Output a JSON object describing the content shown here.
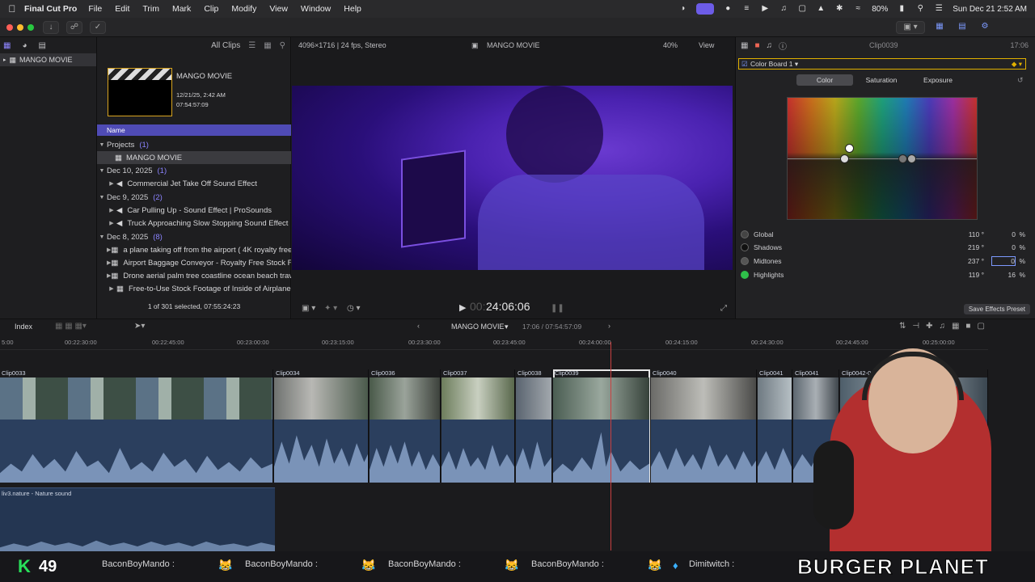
{
  "menubar": {
    "app": "Final Cut Pro",
    "items": [
      "File",
      "Edit",
      "Trim",
      "Mark",
      "Clip",
      "Modify",
      "View",
      "Window",
      "Help"
    ],
    "battery": "80%",
    "datetime": "Sun Dec 21  2:52 AM"
  },
  "library": {
    "name": "MANGO MOVIE"
  },
  "browser": {
    "filter": "All Clips",
    "project_card": {
      "title": "MANGO MOVIE",
      "date": "12/21/25, 2:42 AM",
      "duration": "07:54:57:09"
    },
    "column_header": "Name",
    "groups": [
      {
        "label": "Projects",
        "count": "(1)",
        "items": [
          "MANGO MOVIE"
        ]
      },
      {
        "label": "Dec 10, 2025",
        "count": "(1)",
        "items": [
          "Commercial Jet Take Off Sound Effect"
        ]
      },
      {
        "label": "Dec 9, 2025",
        "count": "(2)",
        "items": [
          "Car Pulling Up - Sound Effect  |  ProSounds",
          "Truck Approaching Slow Stopping Sound Effect"
        ]
      },
      {
        "label": "Dec 8, 2025",
        "count": "(8)",
        "items": [
          "a plane taking off from the airport ( 4K royalty free",
          "Airport Baggage Conveyor - Royalty Free Stock Fo",
          "Drone aerial palm tree coastline ocean beach trave",
          "Free-to-Use Stock Footage of Inside of Airplane"
        ]
      }
    ],
    "selection_status": "1 of 301 selected, 07:55:24:23"
  },
  "viewer": {
    "format": "4096×1716 | 24 fps, Stereo",
    "title": "MANGO MOVIE",
    "zoom": "40%",
    "view_label": "View",
    "timecode_dim": "00:",
    "timecode": "24:06:06"
  },
  "inspector": {
    "clip_name": "Clip0039",
    "duration": "17:06",
    "effect_name": "Color Board 1",
    "tabs": [
      "Color",
      "Saturation",
      "Exposure"
    ],
    "active_tab": "Color",
    "rows": [
      {
        "label": "Global",
        "angle": "110 °",
        "value": "0",
        "unit": "%"
      },
      {
        "label": "Shadows",
        "angle": "219 °",
        "value": "0",
        "unit": "%"
      },
      {
        "label": "Midtones",
        "angle": "237 °",
        "value": "0",
        "unit": "%"
      },
      {
        "label": "Highlights",
        "angle": "119 °",
        "value": "16",
        "unit": "%"
      }
    ],
    "save_preset": "Save Effects Preset"
  },
  "timeline": {
    "index_label": "Index",
    "project": "MANGO MOVIE",
    "position": "17:06 / 07:54:57:09",
    "ruler": [
      "5:00",
      "00:22:30:00",
      "00:22:45:00",
      "00:23:00:00",
      "00:23:15:00",
      "00:23:30:00",
      "00:23:45:00",
      "00:24:00:00",
      "00:24:15:00",
      "00:24:30:00",
      "00:24:45:00",
      "00:25:00:00"
    ],
    "clips": [
      "Clip0033",
      "Clip0034",
      "Clip0036",
      "Clip0037",
      "Clip0038",
      "Clip0039",
      "Clip0040",
      "Clip0041",
      "Clip0041",
      "Clip0042-025"
    ],
    "audio_clip": "liv3.nature - Nature sound"
  },
  "ticker": {
    "k_count": "49",
    "chat": [
      "BaconBoyMando :",
      "BaconBoyMando :",
      "BaconBoyMando :",
      "BaconBoyMando :",
      "Dimitwitch :"
    ],
    "brand": "BURGER PLANET"
  },
  "colors": {
    "accent": "#6c5ce7",
    "selection": "#3a3a8a",
    "audio": "#2b3f5e",
    "highlight_green": "#2fbf4a"
  }
}
